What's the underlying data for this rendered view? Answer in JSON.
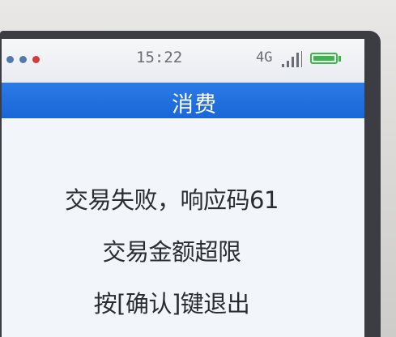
{
  "status_bar": {
    "indicator_dots": [
      "#4a6fb0",
      "#4a6fb0",
      "#d23c3c"
    ],
    "time": "15:22",
    "network": "4G",
    "signal_icon": "signal-bars-icon",
    "battery_icon": "battery-icon",
    "battery_color": "#3fb64b"
  },
  "title_bar": {
    "title": "消费",
    "color": "#1f6fdf"
  },
  "message": {
    "line1": "交易失败，响应码61",
    "line2": "交易金额超限",
    "line3": "按[确认]键退出"
  }
}
